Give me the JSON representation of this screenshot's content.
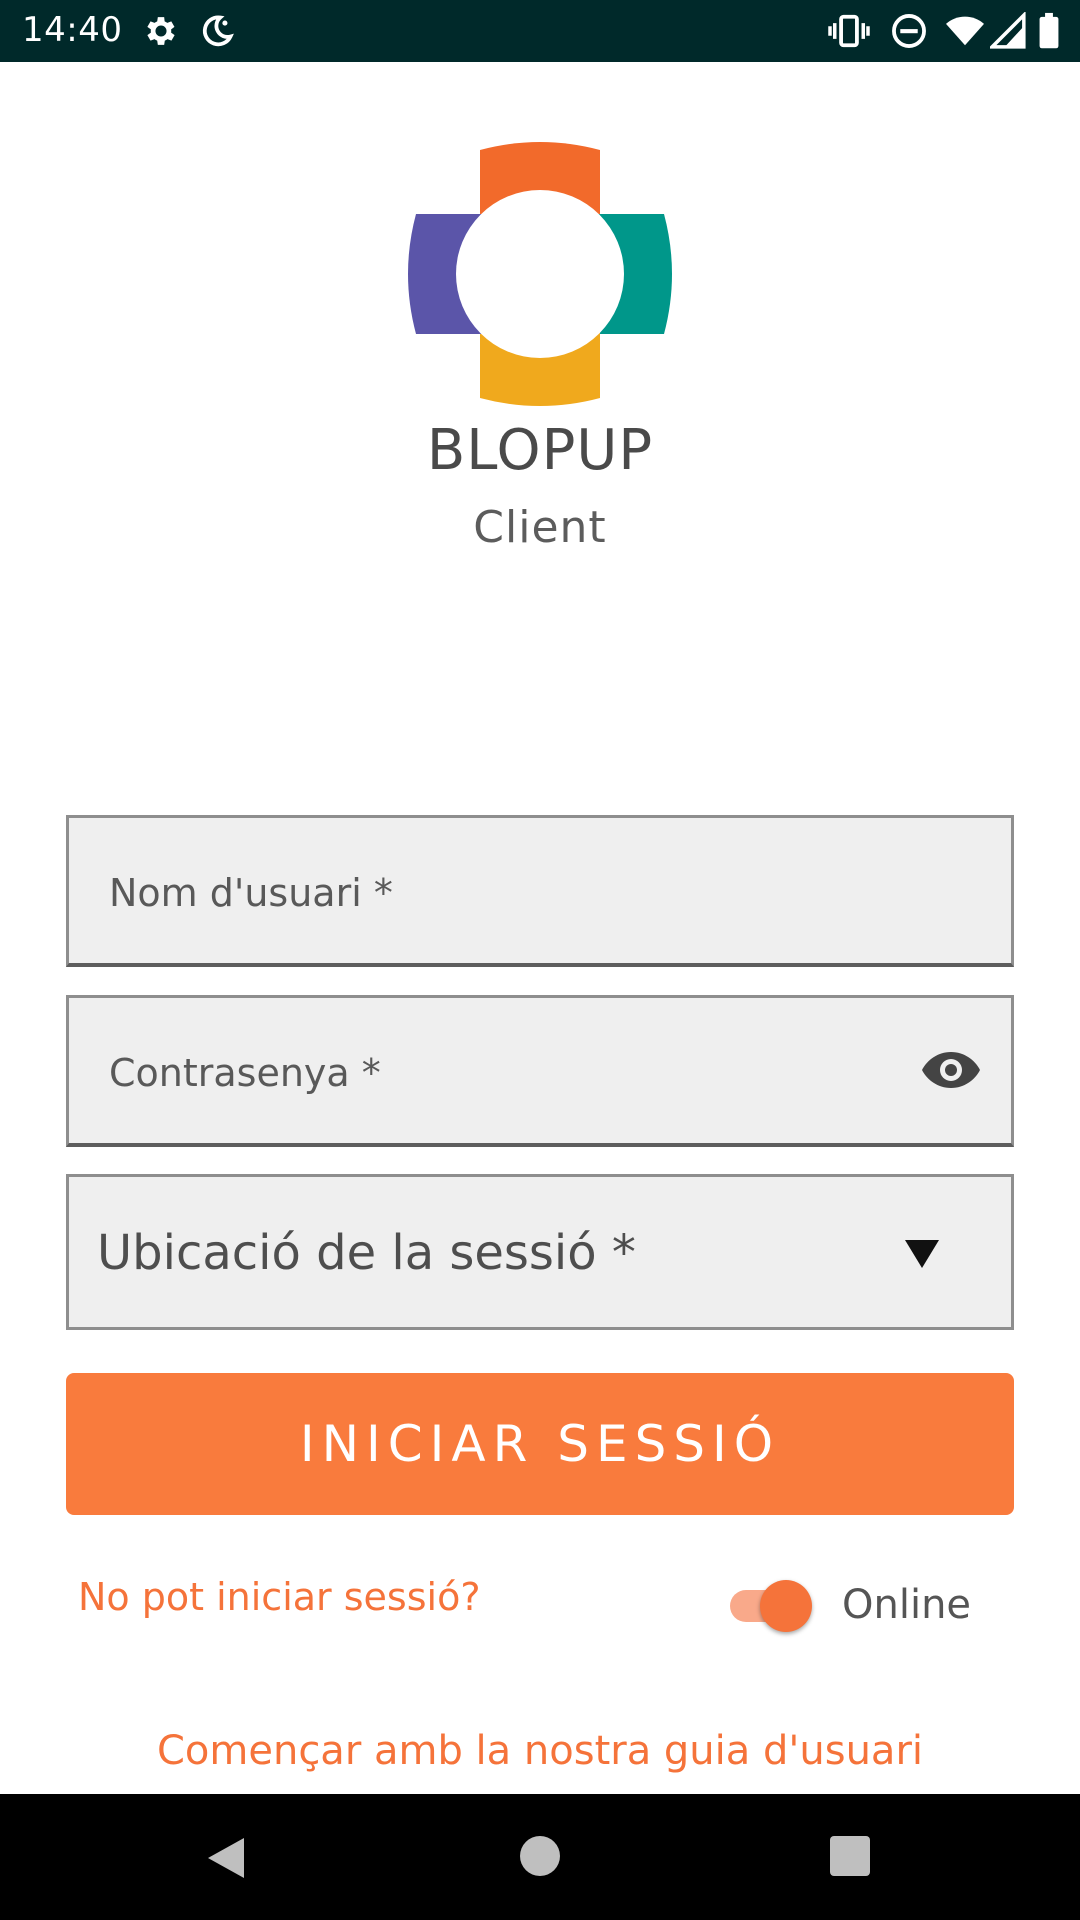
{
  "status_bar": {
    "time": "14:40",
    "left_icons": [
      "gear-icon",
      "do-not-disturb-moon-icon"
    ],
    "right_icons": [
      "vibrate-icon",
      "dnd-minus-icon",
      "wifi-icon",
      "cell-signal-icon",
      "battery-icon"
    ]
  },
  "brand": {
    "name": "BLOPUP",
    "subtitle": "Client",
    "logo_colors": {
      "top": "#f26a2b",
      "right": "#00978a",
      "bottom": "#f0a91d",
      "left": "#5b55a9"
    }
  },
  "form": {
    "username_placeholder": "Nom d'usuari *",
    "password_placeholder": "Contrasenya *",
    "location_placeholder": "Ubicació de la sessió *",
    "login_button": "INICIAR SESSIÓ",
    "forgot_link": "No pot iniciar sessió?",
    "online_toggle_label": "Online",
    "online_toggle_on": true,
    "guide_link": "Començar amb la nostra guia d'usuari"
  },
  "colors": {
    "accent": "#f97b3d",
    "link": "#f5733a",
    "status_bar_bg": "#00292a"
  },
  "nav_bar": {
    "icons": [
      "back-triangle-icon",
      "home-circle-icon",
      "recents-square-icon"
    ]
  }
}
